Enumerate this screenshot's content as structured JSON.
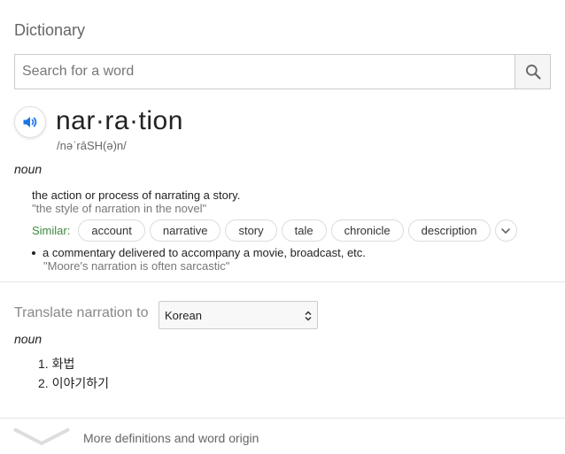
{
  "header": {
    "title": "Dictionary"
  },
  "search": {
    "placeholder": "Search for a word",
    "value": ""
  },
  "entry": {
    "word": "nar·ra·tion",
    "phonetic": "/nəˈrāSH(ə)n/",
    "part_of_speech": "noun",
    "definitions": [
      {
        "text": "the action or process of narrating a story.",
        "example": "\"the style of narration in the novel\"",
        "similar_label": "Similar:",
        "similar": [
          "account",
          "narrative",
          "story",
          "tale",
          "chronicle",
          "description"
        ]
      },
      {
        "text": "a commentary delivered to accompany a movie, broadcast, etc.",
        "example": "\"Moore's narration is often sarcastic\""
      }
    ]
  },
  "translate": {
    "label": "Translate narration to",
    "language": "Korean",
    "part_of_speech": "noun",
    "items": [
      "1. 화법",
      "2. 이야기하기"
    ]
  },
  "footer": {
    "more_label": "More definitions and word origin"
  },
  "colors": {
    "accent": "#1a73e8",
    "similar_label": "#3c8a3c",
    "muted": "#777777"
  },
  "icons": [
    "search-icon",
    "speaker-icon",
    "chevron-down-icon",
    "select-caret-icon"
  ]
}
